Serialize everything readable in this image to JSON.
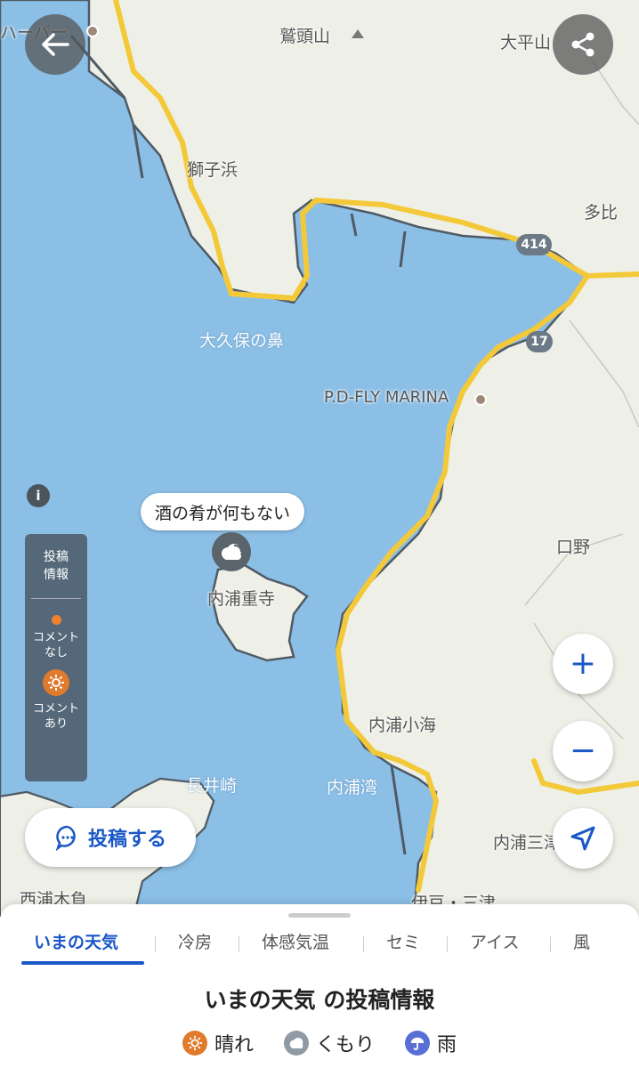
{
  "map": {
    "colors": {
      "water": "#8bbfe6",
      "land": "#eef0e8",
      "road": "#f3c93a",
      "coast": "#4f5a63"
    },
    "place_labels": [
      {
        "id": "harbor",
        "text": "ハーバー"
      },
      {
        "id": "washizu",
        "text": "鷲頭山"
      },
      {
        "id": "ohira",
        "text": "大平山"
      },
      {
        "id": "shishihama",
        "text": "獅子浜"
      },
      {
        "id": "tai",
        "text": "多比"
      },
      {
        "id": "okubo",
        "text": "大久保の鼻"
      },
      {
        "id": "marina",
        "text": "P.D-FLY MARINA"
      },
      {
        "id": "kuchino",
        "text": "口野"
      },
      {
        "id": "juji",
        "text": "内浦重寺"
      },
      {
        "id": "koumi",
        "text": "内浦小海"
      },
      {
        "id": "nagaizaki",
        "text": "長井崎"
      },
      {
        "id": "uchiurawan",
        "text": "内浦湾"
      },
      {
        "id": "mito",
        "text": "内浦三津"
      },
      {
        "id": "nishiura",
        "text": "西浦木負"
      },
      {
        "id": "izumito",
        "text": "伊豆・三津"
      }
    ],
    "road_shields": [
      {
        "id": "r414",
        "text": "414"
      },
      {
        "id": "r17",
        "text": "17"
      }
    ],
    "post_bubble": {
      "text": "酒の肴が何もない",
      "weather": "cloudy-icon"
    },
    "info_icon": "i"
  },
  "controls": {
    "back": "arrow-left-icon",
    "share": "share-icon",
    "zoom_in": "+",
    "zoom_out": "−",
    "locate": "navigation-arrow-icon"
  },
  "legend": {
    "title_line1": "投稿",
    "title_line2": "情報",
    "no_comment_line1": "コメント",
    "no_comment_line2": "なし",
    "comment_line1": "コメント",
    "comment_line2": "あり",
    "colors": {
      "dot": "#f08030"
    }
  },
  "post_button": {
    "label": "投稿する"
  },
  "sheet": {
    "tabs": [
      "いまの天気",
      "冷房",
      "体感気温",
      "セミ",
      "アイス",
      "風"
    ],
    "active_tab": "いまの天気",
    "title": "いまの天気 の投稿情報",
    "weather_legend": [
      {
        "label": "晴れ",
        "icon": "sun-icon",
        "color": "#e07a2c"
      },
      {
        "label": "くもり",
        "icon": "cloud-icon",
        "color": "#8f9aa5"
      },
      {
        "label": "雨",
        "icon": "umbrella-icon",
        "color": "#5a6fd6"
      }
    ]
  }
}
